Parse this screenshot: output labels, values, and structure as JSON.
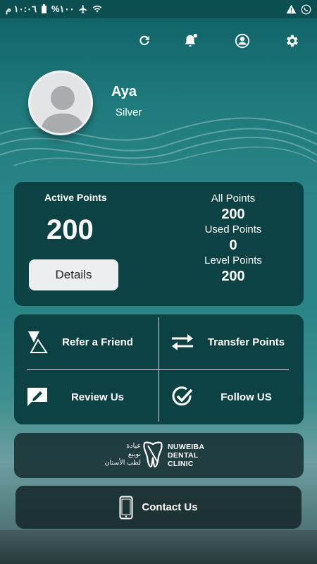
{
  "status_bar": {
    "time": "١٠:٠٦ م",
    "battery": "%١٠٠"
  },
  "top_icons": [
    "refresh-icon",
    "bell-icon",
    "profile-icon",
    "settings-icon"
  ],
  "user": {
    "name": "Aya",
    "level": "Silver"
  },
  "points": {
    "active_label": "Active Points",
    "active_value": "200",
    "details_label": "Details",
    "all_label": "All Points",
    "all_value": "200",
    "used_label": "Used Points",
    "used_value": "0",
    "level_label": "Level Points",
    "level_value": "200"
  },
  "actions": {
    "refer": "Refer a Friend",
    "transfer": "Transfer Points",
    "review": "Review Us",
    "follow": "Follow US"
  },
  "clinic": {
    "ar_line1": "عيادة",
    "ar_line2": "نويبع",
    "ar_line3": "لطب الأسنان",
    "en_line1": "NUWEIBA",
    "en_line2": "DENTAL",
    "en_line3": "CLINIC"
  },
  "contact_label": "Contact Us",
  "colors": {
    "card": "#0d4245",
    "background": "#2a8586",
    "button": "#eceeef"
  }
}
